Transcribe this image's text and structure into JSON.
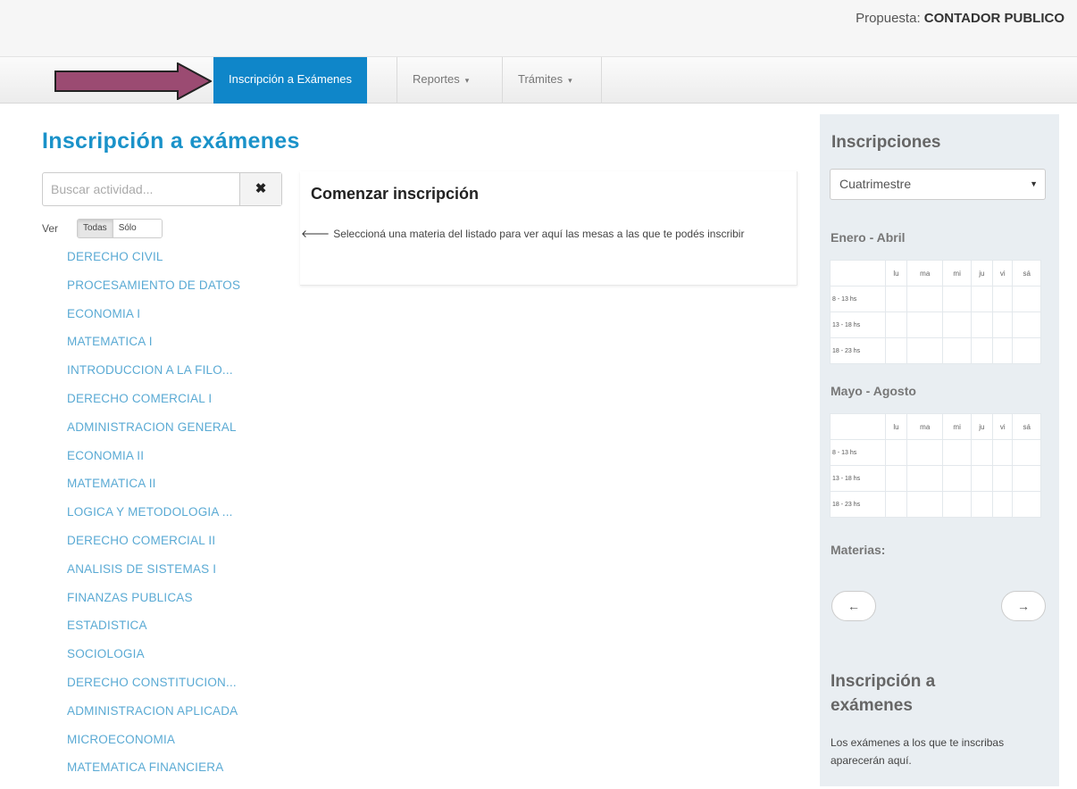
{
  "header": {
    "propuesta_label": "Propuesta:",
    "propuesta_value": "CONTADOR PUBLICO"
  },
  "colors": {
    "accent": "#0f86c9",
    "title": "#1a92c9",
    "link": "#5aaad4",
    "arrow": "#9b4b72"
  },
  "nav": {
    "items": [
      {
        "label": "Inscripción a Exámenes",
        "active": true
      },
      {
        "label": "Reportes",
        "caret": "▾"
      },
      {
        "label": "Trámites",
        "caret": "▾"
      }
    ]
  },
  "page": {
    "title": "Inscripción a exámenes"
  },
  "search": {
    "placeholder": "Buscar actividad...",
    "clear_icon": "✖"
  },
  "filter": {
    "ver_label": "Ver",
    "options": [
      "Todas",
      "Sólo inscriptas"
    ]
  },
  "subjects": [
    "DERECHO CIVIL",
    "PROCESAMIENTO DE DATOS",
    "ECONOMIA I",
    "MATEMATICA I",
    "INTRODUCCION A LA FILO...",
    "DERECHO COMERCIAL I",
    "ADMINISTRACION GENERAL",
    "ECONOMIA II",
    "MATEMATICA II",
    "LOGICA Y METODOLOGIA ...",
    "DERECHO COMERCIAL II",
    "ANALISIS DE SISTEMAS I",
    "FINANZAS PUBLICAS",
    "ESTADISTICA",
    "SOCIOLOGIA",
    "DERECHO CONSTITUCION...",
    "ADMINISTRACION APLICADA",
    "MICROECONOMIA",
    "MATEMATICA FINANCIERA"
  ],
  "main": {
    "title": "Comenzar inscripción",
    "text": "Seleccioná una materia del listado para ver aquí las mesas a las que te podés inscribir"
  },
  "sidebar": {
    "title": "Inscripciones",
    "select_value": "Cuatrimestre",
    "days": [
      "lu",
      "ma",
      "mi",
      "ju",
      "vi",
      "sá"
    ],
    "periods": [
      {
        "label": "Enero - Abril",
        "rows": [
          "8 - 13 hs",
          "13 - 18 hs",
          "18 - 23 hs"
        ]
      },
      {
        "label": "Mayo - Agosto",
        "rows": [
          "8 - 13 hs",
          "13 - 18 hs",
          "18 - 23 hs"
        ]
      }
    ],
    "materias_label": "Materias:",
    "prev_label": "←",
    "next_label": "→",
    "exams_title": "Inscripción a exámenes",
    "exams_note": "Los exámenes a los que te inscribas aparecerán aquí."
  }
}
